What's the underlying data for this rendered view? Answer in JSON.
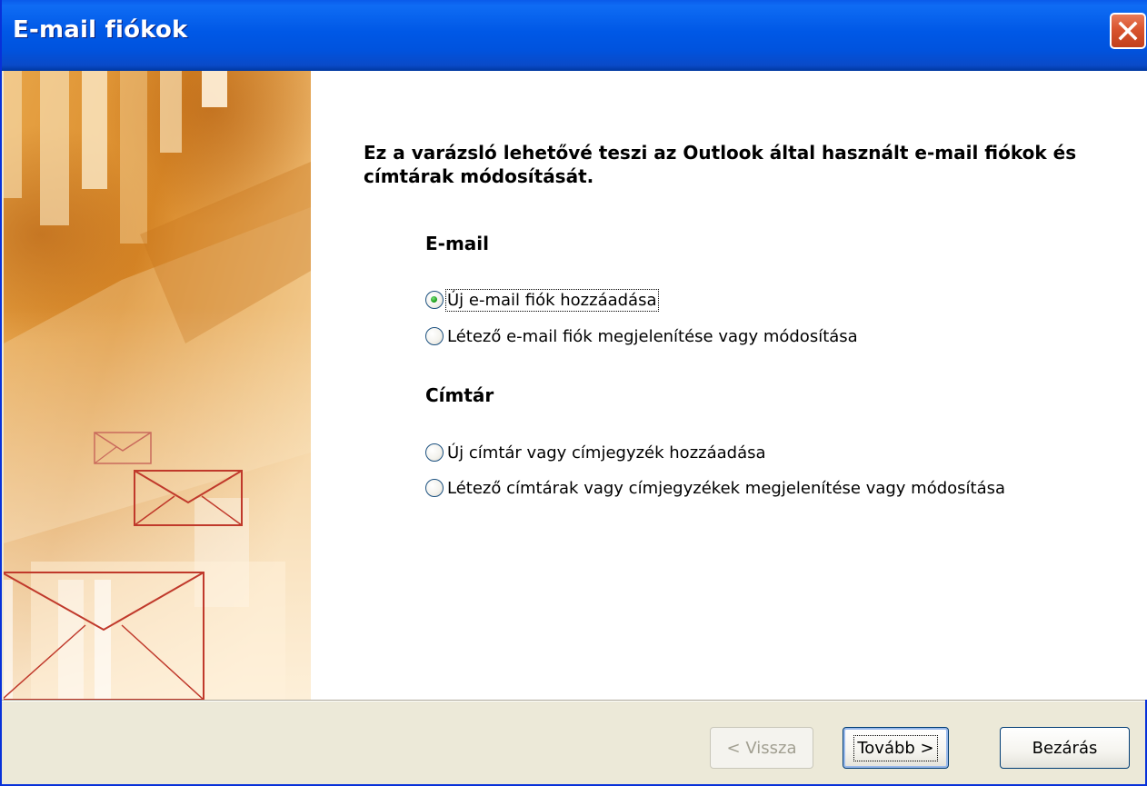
{
  "window": {
    "title": "E-mail fiókok",
    "colors": {
      "titlebar": "#0058E6",
      "close": "#D9542E",
      "face": "#ECE9D8",
      "radio_checked": "#21A121"
    }
  },
  "titlebar": {
    "close_icon": "close-icon"
  },
  "intro": "Ez a varázsló lehetővé teszi az Outlook által használt e-mail fiókok és címtárak módosítását.",
  "email_section": {
    "heading": "E-mail",
    "options": [
      {
        "label": "Új e-mail fiók hozzáadása",
        "checked": true
      },
      {
        "label": "Létező e-mail fiók megjelenítése vagy módosítása",
        "checked": false
      }
    ]
  },
  "directory_section": {
    "heading": "Címtár",
    "options": [
      {
        "label": "Új címtár vagy címjegyzék hozzáadása",
        "checked": false
      },
      {
        "label": "Létező címtárak vagy címjegyzékek megjelenítése vagy módosítása",
        "checked": false
      }
    ]
  },
  "buttons": {
    "back": "< Vissza",
    "next": "Tovább >",
    "close": "Bezárás"
  }
}
